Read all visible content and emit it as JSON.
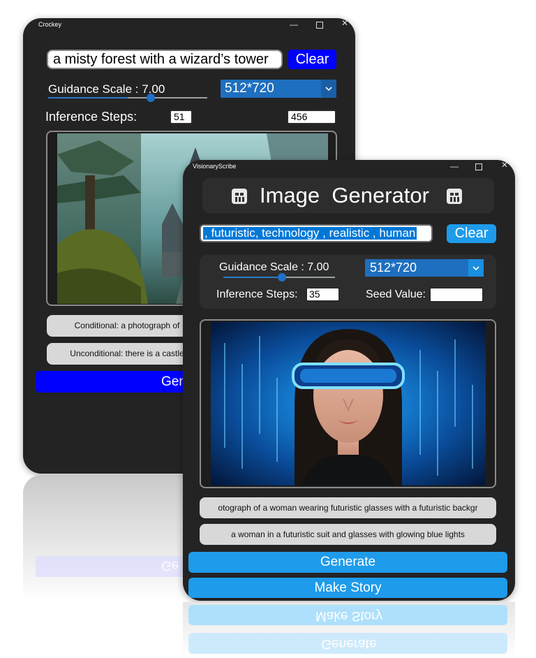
{
  "back_window": {
    "title": "Crockey",
    "prompt_value": "a misty forest with a wizard’s tower",
    "clear_label": "Clear",
    "guidance_label": "Guidance Scale : 7.00",
    "guidance_fraction": 0.5,
    "size_value": "512*720",
    "steps_label": "Inference Steps:",
    "steps_value": "51",
    "seed_value": "456",
    "conditional_text": "Conditional: a photograph of",
    "unconditional_text": "Unconditional: there is a castle",
    "generate_label": "Gen",
    "colors": {
      "accent": "#0000ff",
      "dropdown": "#1e6fbf"
    }
  },
  "front_window": {
    "title": "VisionaryScribe",
    "header_title": "Image  Generator",
    "prompt_value": ", futuristic, technology , realistic , human",
    "clear_label": "Clear",
    "guidance_label": "Guidance Scale : 7.00",
    "guidance_fraction": 0.5,
    "size_value": "512*720",
    "steps_label": "Inference Steps:",
    "steps_value": "35",
    "seed_label": "Seed Value:",
    "seed_value": "",
    "caption_1": "otograph of a woman wearing futuristic glasses with a futuristic backgr",
    "caption_2": "a woman in a futuristic suit and glasses with glowing blue lights",
    "generate_label": "Generate",
    "story_label": "Make Story",
    "colors": {
      "accent": "#1e9bea",
      "dropdown": "#1e6fbf"
    }
  },
  "reflection": {
    "generate_label": "Generate",
    "story_label": "Make Story",
    "back_generate_label": "Ge"
  }
}
